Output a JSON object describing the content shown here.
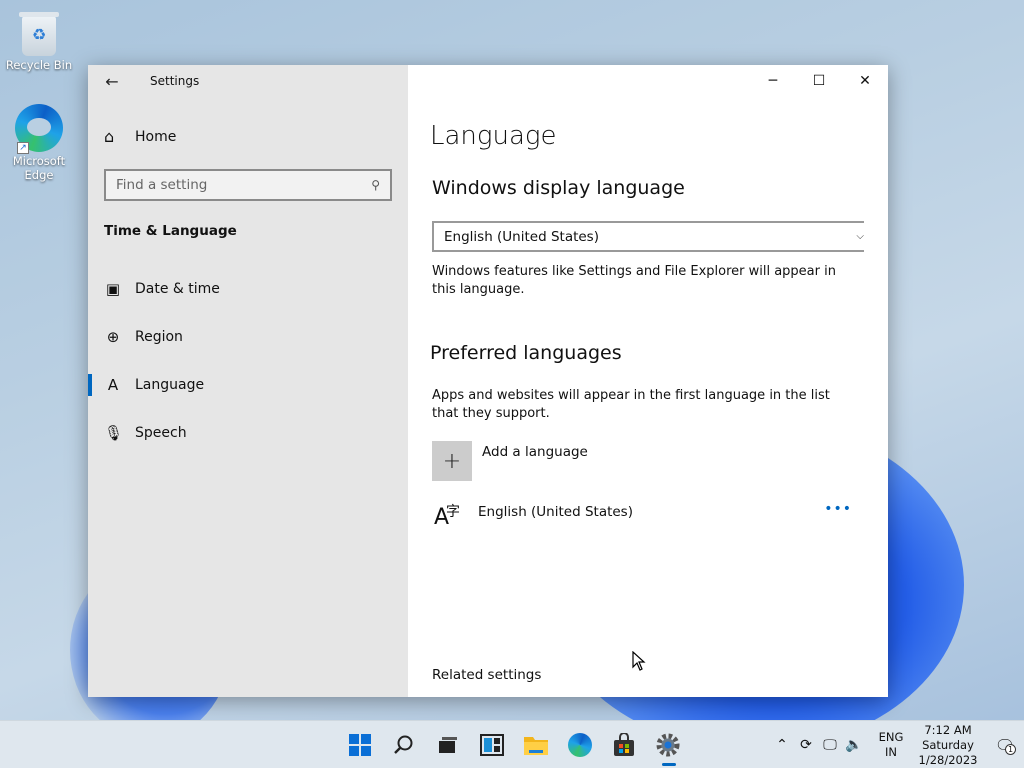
{
  "desktop": {
    "icons": [
      {
        "label": "Recycle Bin"
      },
      {
        "label": "Microsoft Edge"
      }
    ]
  },
  "window": {
    "title": "Settings",
    "controls": {
      "minimize": "─",
      "maximize": "☐",
      "close": "✕"
    }
  },
  "sidebar": {
    "home_label": "Home",
    "search_placeholder": "Find a setting",
    "section_title": "Time & Language",
    "items": [
      {
        "label": "Date & time",
        "icon": "calendar-clock-icon",
        "active": false
      },
      {
        "label": "Region",
        "icon": "globe-icon",
        "active": false
      },
      {
        "label": "Language",
        "icon": "language-icon",
        "active": true
      },
      {
        "label": "Speech",
        "icon": "microphone-icon",
        "active": false
      }
    ]
  },
  "main": {
    "page_title": "Language",
    "display_language": {
      "heading": "Windows display language",
      "selected": "English (United States)",
      "description": "Windows features like Settings and File Explorer will appear in this language."
    },
    "preferred": {
      "heading": "Preferred languages",
      "description": "Apps and websites will appear in the first language in the list that they support.",
      "add_label": "Add a language",
      "languages": [
        {
          "name": "English (United States)"
        }
      ]
    },
    "related_settings": "Related settings"
  },
  "taskbar": {
    "apps": [
      "start",
      "search",
      "task-view",
      "widgets",
      "file-explorer",
      "edge",
      "store",
      "settings"
    ],
    "active_app": "settings",
    "lang_line1": "ENG",
    "lang_line2": "IN",
    "time": "7:12 AM",
    "day": "Saturday",
    "date": "1/28/2023",
    "notification_count": "1"
  },
  "colors": {
    "accent": "#0067c0",
    "sidebar_bg": "#e6e6e6",
    "taskbar_bg": "#dfe7ee"
  }
}
